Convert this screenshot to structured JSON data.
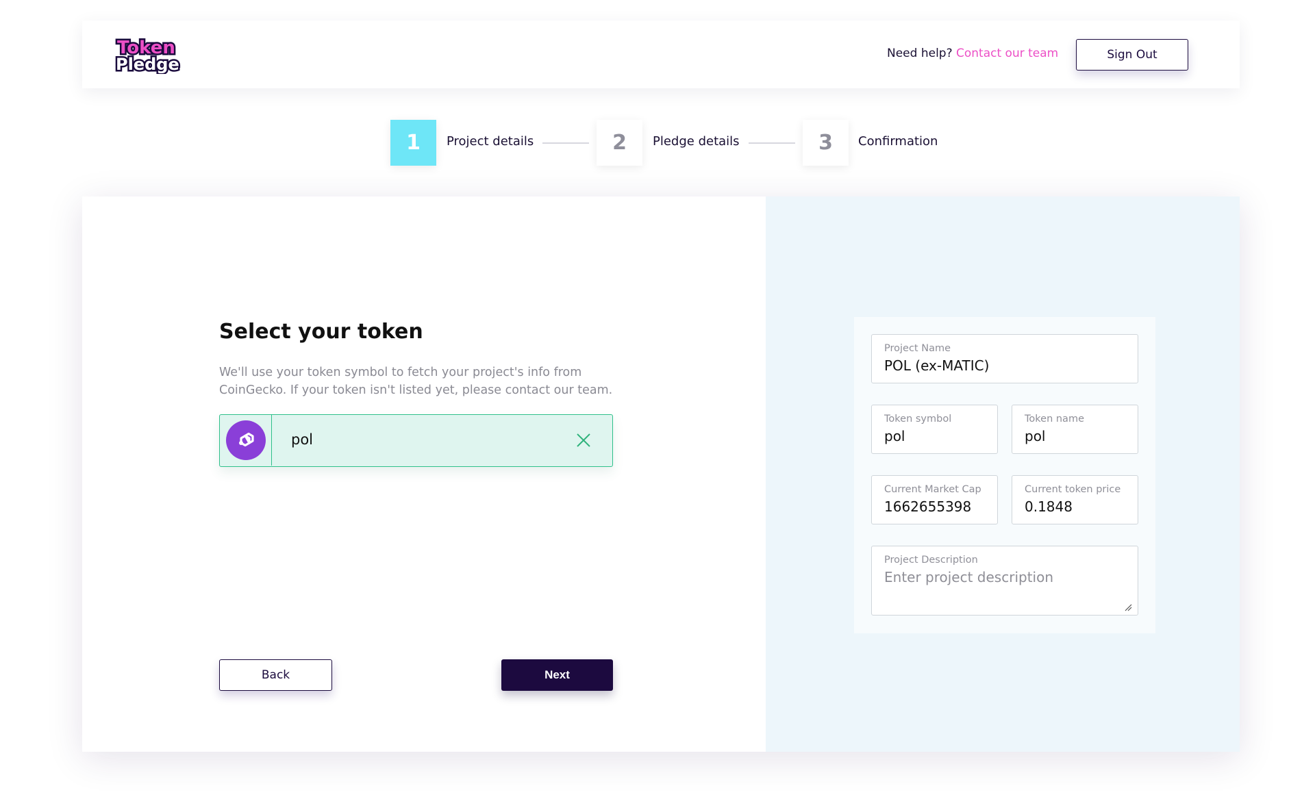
{
  "header": {
    "logo_text": [
      "Token",
      "Pledge"
    ],
    "help_text": "Need help?",
    "help_link": "Contact our team",
    "signout_label": "Sign Out"
  },
  "stepper": {
    "steps": [
      {
        "number": "1",
        "label": "Project details",
        "active": true
      },
      {
        "number": "2",
        "label": "Pledge details",
        "active": false
      },
      {
        "number": "3",
        "label": "Confirmation",
        "active": false
      }
    ]
  },
  "left": {
    "title": "Select your token",
    "description": "We'll use your token symbol to fetch your project's info from CoinGecko. If your token isn't listed yet, please contact our team.",
    "token_input_value": "pol",
    "back_label": "Back",
    "next_label": "Next"
  },
  "details": {
    "project_name": {
      "label": "Project Name",
      "value": "POL (ex-MATIC)"
    },
    "token_symbol": {
      "label": "Token symbol",
      "value": "pol"
    },
    "token_name": {
      "label": "Token name",
      "value": "pol"
    },
    "market_cap": {
      "label": "Current Market Cap",
      "value": "1662655398"
    },
    "token_price": {
      "label": "Current token price",
      "value": "0.1848"
    },
    "description": {
      "label": "Project Description",
      "placeholder": "Enter project description"
    }
  },
  "colors": {
    "brand_navy": "#1c0a3f",
    "accent_pink": "#ec4fc6",
    "step_active": "#6ee6f7",
    "success_green": "#2fc08a",
    "input_success_bg": "#dff5ef",
    "token_purple": "#8a3fd8",
    "panel_bg": "#edf6fb"
  },
  "icons": [
    "token-pledge-logo",
    "polygon-token-icon",
    "close-icon",
    "resize-handle-icon"
  ]
}
